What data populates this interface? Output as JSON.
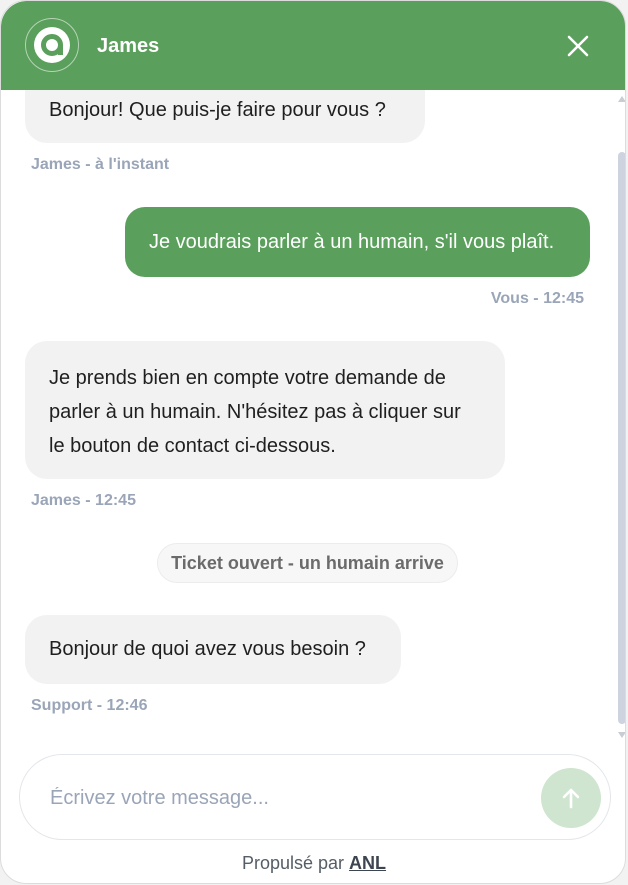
{
  "header": {
    "title": "James",
    "logo_icon": "chat-logo-icon",
    "close_icon": "close-icon",
    "color": "#5a9f5b"
  },
  "messages": [
    {
      "sender": "bot",
      "text": "Bonjour! Que puis-je faire pour vous ?",
      "meta": "James - à l'instant"
    },
    {
      "sender": "user",
      "text": "Je voudrais parler à un humain, s'il vous plaît.",
      "meta": "Vous - 12:45"
    },
    {
      "sender": "bot",
      "lines": [
        "Je prends bien en compte votre demande de",
        "parler à un humain. N'hésitez pas à cliquer sur",
        "le bouton de contact ci-dessous."
      ],
      "meta": "James - 12:45"
    },
    {
      "sender": "system",
      "text": "Ticket ouvert - un humain arrive"
    },
    {
      "sender": "support",
      "text": "Bonjour de quoi avez vous besoin ?",
      "meta": "Support - 12:46"
    }
  ],
  "composer": {
    "placeholder": "Écrivez votre message...",
    "send_icon": "arrow-up-icon"
  },
  "footer": {
    "prefix": "Propulsé par",
    "brand": "ANL"
  },
  "colors": {
    "accent": "#5a9f5b",
    "bubble_bot": "#f2f2f2",
    "meta_text": "#9aa5b8"
  }
}
